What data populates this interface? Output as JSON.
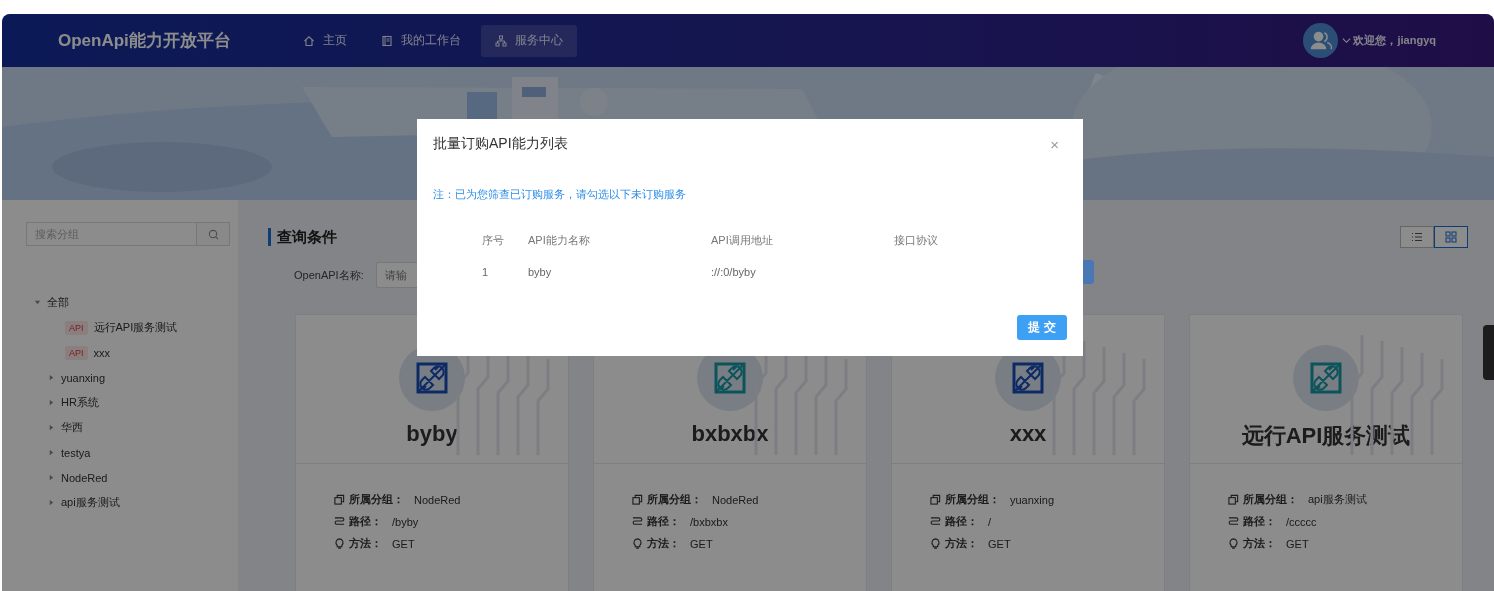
{
  "header": {
    "logo": "OpenApi能力开放平台",
    "nav": [
      {
        "label": "主页",
        "selected": false
      },
      {
        "label": "我的工作台",
        "selected": false
      },
      {
        "label": "服务中心",
        "selected": true
      }
    ],
    "greeting": "欢迎您，jiangyq"
  },
  "sidebar": {
    "search_placeholder": "搜索分组",
    "tree": [
      {
        "label": "全部",
        "expanded": true,
        "children": [
          {
            "tag": "API",
            "label": "远行API服务测试"
          },
          {
            "tag": "API",
            "label": "xxx"
          }
        ]
      },
      {
        "label": "yuanxing",
        "expanded": false
      },
      {
        "label": "HR系统",
        "expanded": false
      },
      {
        "label": "华西",
        "expanded": false
      },
      {
        "label": "testya",
        "expanded": false
      },
      {
        "label": "NodeRed",
        "expanded": false
      },
      {
        "label": "api服务测试",
        "expanded": false
      }
    ]
  },
  "query": {
    "title": "查询条件",
    "field_label": "OpenAPI名称:",
    "placeholder": "请输"
  },
  "view_toggle": [
    {
      "kind": "list",
      "selected": false
    },
    {
      "kind": "grid",
      "selected": true
    }
  ],
  "cards": [
    {
      "name": "byby",
      "color": "#0e2b65",
      "fields": [
        {
          "kind": "group",
          "label": "所属分组：",
          "value": "NodeRed"
        },
        {
          "kind": "path",
          "label": "路径：",
          "value": "/byby"
        },
        {
          "kind": "method",
          "label": "方法：",
          "value": "GET"
        }
      ]
    },
    {
      "name": "bxbxbx",
      "color": "#0d535b",
      "fields": [
        {
          "kind": "group",
          "label": "所属分组：",
          "value": "NodeRed"
        },
        {
          "kind": "path",
          "label": "路径：",
          "value": "/bxbxbx"
        },
        {
          "kind": "method",
          "label": "方法：",
          "value": "GET"
        }
      ]
    },
    {
      "name": "xxx",
      "color": "#0e2b65",
      "fields": [
        {
          "kind": "group",
          "label": "所属分组：",
          "value": "yuanxing"
        },
        {
          "kind": "path",
          "label": "路径：",
          "value": "/"
        },
        {
          "kind": "method",
          "label": "方法：",
          "value": "GET"
        }
      ]
    },
    {
      "name": "远行API服务测试",
      "color": "#0d535b",
      "fields": [
        {
          "kind": "group",
          "label": "所属分组：",
          "value": "api服务测试"
        },
        {
          "kind": "path",
          "label": "路径：",
          "value": "/ccccc"
        },
        {
          "kind": "method",
          "label": "方法：",
          "value": "GET"
        }
      ]
    }
  ],
  "modal": {
    "title": "批量订购API能力列表",
    "close": "×",
    "note": "注：已为您筛查已订购服务，请勾选以下未订购服务",
    "columns": [
      "序号",
      "API能力名称",
      "API调用地址",
      "接口协议"
    ],
    "rows": [
      {
        "index": "1",
        "name": "byby",
        "url": "://:0/byby"
      }
    ],
    "submit": "提 交"
  }
}
